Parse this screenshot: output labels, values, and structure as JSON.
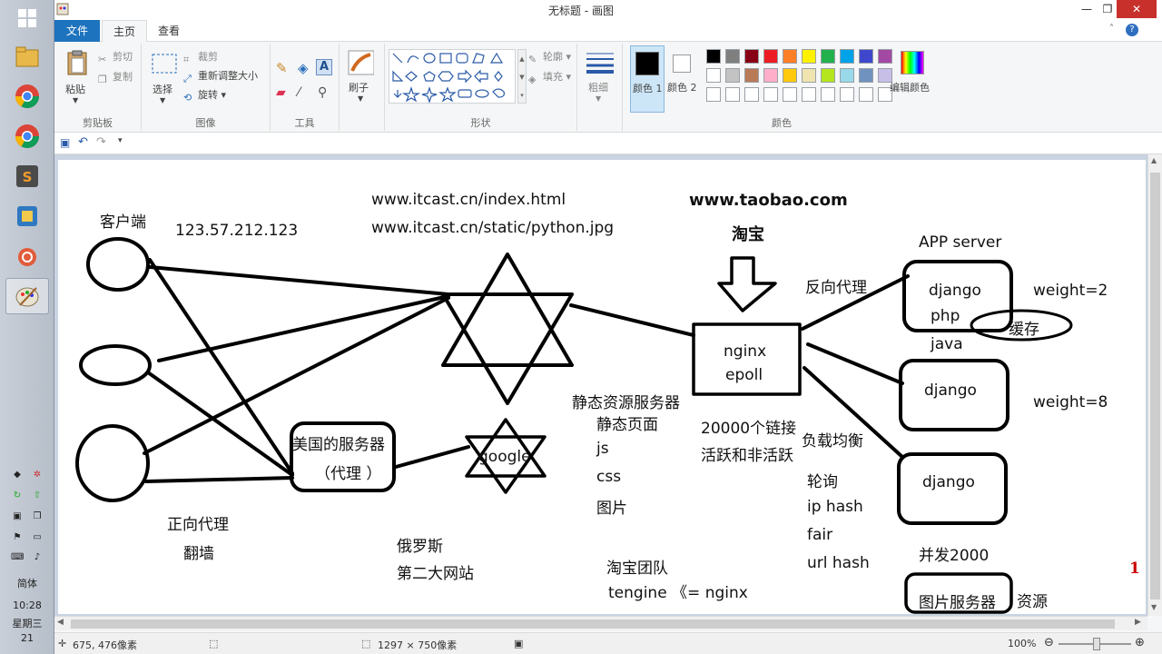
{
  "window": {
    "title": "无标题 - 画图"
  },
  "tabs": {
    "file": "文件",
    "home": "主页",
    "view": "查看"
  },
  "ribbon": {
    "clipboard": {
      "label": "剪贴板",
      "paste": "粘贴",
      "cut": "剪切",
      "copy": "复制"
    },
    "image": {
      "label": "图像",
      "select": "选择",
      "crop": "裁剪",
      "resize": "重新调整大小",
      "rotate": "旋转"
    },
    "tools": {
      "label": "工具"
    },
    "brush": {
      "label": "刷子"
    },
    "shapes": {
      "label": "形状",
      "outline": "轮廓",
      "fill": "填充"
    },
    "size": {
      "label": "粗细"
    },
    "colors": {
      "label": "颜色",
      "color1": "颜色 1",
      "color2": "颜色 2",
      "edit": "编辑颜色",
      "palette_row1": [
        "#000000",
        "#7f7f7f",
        "#880015",
        "#ed1c24",
        "#ff7f27",
        "#fff200",
        "#22b14c",
        "#00a2e8",
        "#3f48cc",
        "#a349a4"
      ],
      "palette_row2": [
        "#ffffff",
        "#c3c3c3",
        "#b97a57",
        "#ffaec9",
        "#ffc90e",
        "#efe4b0",
        "#b5e61d",
        "#99d9ea",
        "#7092be",
        "#c8bfe7"
      ]
    }
  },
  "canvas": {
    "client": "客户端",
    "ip": "123.57.212.123",
    "url1": "www.itcast.cn/index.html",
    "url2": "www.itcast.cn/static/python.jpg",
    "taobao_url": "www.taobao.com",
    "taobao": "淘宝",
    "app_server": "APP server",
    "reverse_proxy": "反向代理",
    "django1": "django",
    "php": "php",
    "java": "java",
    "cache": "缓存",
    "weight2": "weight=2",
    "django2": "django",
    "weight8": "weight=8",
    "django3": "django",
    "nginx": "nginx",
    "epoll": "epoll",
    "static_server": "静态资源服务器",
    "static_page": "静态页面",
    "js": "js",
    "css": "css",
    "images": "图片",
    "connections": "20000个链接",
    "active": "活跃和非活跃",
    "load_balance": "负载均衡",
    "round_robin": "轮询",
    "ip_hash": "ip hash",
    "fair": "fair",
    "url_hash": "url hash",
    "concurrency": "并发2000",
    "image_server": "图片服务器",
    "resources": "资源",
    "us_server": "美国的服务器",
    "proxy": "（代理 ）",
    "google": "google",
    "forward_proxy": "正向代理",
    "wall": "翻墙",
    "russia": "俄罗斯",
    "second_site": "第二大网站",
    "taobao_team": "淘宝团队",
    "tengine": "tengine  《= nginx",
    "red_mark": "1"
  },
  "status": {
    "cursor_pos": "675, 476像素",
    "canvas_size": "1297 × 750像素",
    "zoom": "100%"
  },
  "taskbar": {
    "lang": "简体",
    "time": "10:28",
    "weekday": "星期三",
    "date": "21"
  }
}
